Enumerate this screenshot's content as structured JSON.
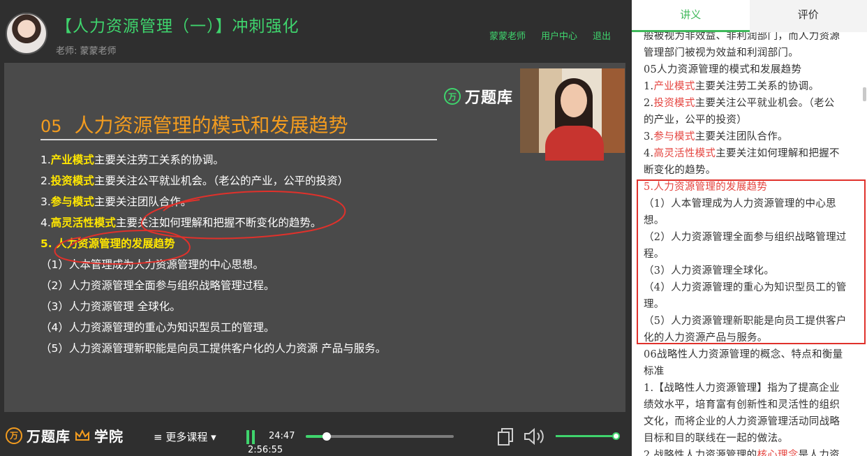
{
  "header": {
    "course_title": "【人力资源管理（一）】冲刺强化",
    "teacher": "老师: 蒙蒙老师",
    "nav": [
      "蒙蒙老师",
      "用户中心",
      "退出"
    ]
  },
  "slide": {
    "logo_badge": "万",
    "logo_text": "万题库",
    "heading_num": "05",
    "heading_text": "人力资源管理的模式和发展趋势",
    "lines": [
      {
        "prefix": "1.",
        "hl": "产业模式",
        "rest": "主要关注劳工关系的协调。"
      },
      {
        "prefix": "2.",
        "hl": "投资模式",
        "rest": "主要关注公平就业机会。（老公的产业，公平的投资）"
      },
      {
        "prefix": "3.",
        "hl": "参与模式",
        "rest": "主要关注团队合作。"
      },
      {
        "prefix": "4.",
        "hl": "高灵活性模式",
        "rest": "主要关注如何理解和把握不断变化的趋势。"
      },
      {
        "prefix": "",
        "hl": "5. 人力资源管理的发展趋势",
        "rest": ""
      },
      {
        "prefix": "（1）人本管理成为人力资源管理的中心思想。",
        "hl": "",
        "rest": ""
      },
      {
        "prefix": "（2）人力资源管理全面参与组织战略管理过程。",
        "hl": "",
        "rest": ""
      },
      {
        "prefix": "（3）人力资源管理 全球化。",
        "hl": "",
        "rest": ""
      },
      {
        "prefix": "（4）人力资源管理的重心为知识型员工的管理。",
        "hl": "",
        "rest": ""
      },
      {
        "prefix": "（5）人力资源管理新职能是向员工提供客户化的人力资源 产品与服务。",
        "hl": "",
        "rest": ""
      }
    ]
  },
  "controls": {
    "brand_badge": "万",
    "brand_text": "万题库",
    "brand_icon": "crown-icon",
    "brand_suffix": "学院",
    "more_courses": "≡ 更多课程 ▾",
    "current_time": "24:47",
    "total_time": "2:56:55",
    "progress": 0.14,
    "volume": 1.0
  },
  "panel": {
    "tabs": [
      "讲义",
      "评价"
    ],
    "active_tab": 0,
    "notes": [
      [
        {
          "t": "般被视为非效益、非利润部门，而人力资源"
        }
      ],
      [
        {
          "t": "管理部门被视为效益和利润部门。"
        }
      ],
      [
        {
          "t": "05人力资源管理的模式和发展趋势"
        }
      ],
      [
        {
          "t": "1."
        },
        {
          "t": "产业模式",
          "red": true
        },
        {
          "t": "主要关注劳工关系的协调。"
        }
      ],
      [
        {
          "t": "2."
        },
        {
          "t": "投资模式",
          "red": true
        },
        {
          "t": "主要关注公平就业机会。（老公"
        }
      ],
      [
        {
          "t": "的产业，公平的投资）"
        }
      ],
      [
        {
          "t": "3."
        },
        {
          "t": "参与模式",
          "red": true
        },
        {
          "t": "主要关注团队合作。"
        }
      ],
      [
        {
          "t": "4."
        },
        {
          "t": "高灵活性模式",
          "red": true
        },
        {
          "t": "主要关注如何理解和把握不"
        }
      ],
      [
        {
          "t": "断变化的趋势。"
        }
      ],
      [
        {
          "t": "5.人力资源管理的发展趋势",
          "red": true
        }
      ],
      [
        {
          "t": "（1）人本管理成为人力资源管理的中心思"
        }
      ],
      [
        {
          "t": "想。"
        }
      ],
      [
        {
          "t": "（2）人力资源管理全面参与组织战略管理过"
        }
      ],
      [
        {
          "t": "程。"
        }
      ],
      [
        {
          "t": "（3）人力资源管理全球化。"
        }
      ],
      [
        {
          "t": "（4）人力资源管理的重心为知识型员工的管"
        }
      ],
      [
        {
          "t": "理。"
        }
      ],
      [
        {
          "t": "（5）人力资源管理新职能是向员工提供客户"
        }
      ],
      [
        {
          "t": "化的人力资源产品与服务。"
        }
      ],
      [
        {
          "t": "06战略性人力资源管理的概念、特点和衡量"
        }
      ],
      [
        {
          "t": "标准"
        }
      ],
      [
        {
          "t": "1.【战略性人力资源管理】指为了提高企业"
        }
      ],
      [
        {
          "t": "绩效水平，培育富有创新性和灵活性的组织"
        }
      ],
      [
        {
          "t": "文化，而将企业的人力资源管理活动同战略"
        }
      ],
      [
        {
          "t": "目标和目的联线在一起的做法。"
        }
      ],
      [
        {
          "t": "2.战略性人力资源管理的"
        },
        {
          "t": "核心理念",
          "red": true
        },
        {
          "t": "是人力资"
        }
      ]
    ]
  },
  "colors": {
    "accent": "#3fd46d",
    "highlight": "#ffe600",
    "heading": "#f39c1f",
    "note_red": "#e5443f",
    "box": "#e0312b"
  }
}
